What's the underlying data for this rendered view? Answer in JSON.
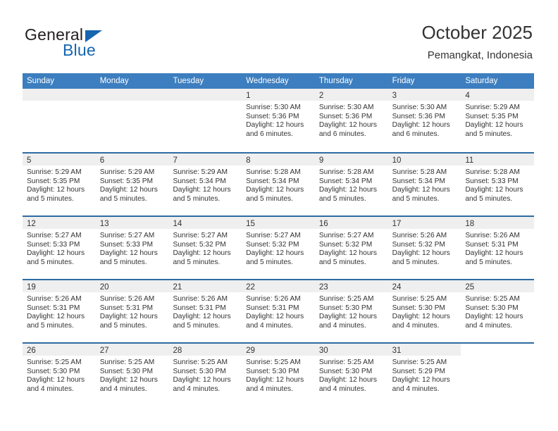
{
  "brand": {
    "name_part1": "General",
    "name_part2": "Blue"
  },
  "header": {
    "title": "October 2025",
    "subtitle": "Pemangkat, Indonesia"
  },
  "colors": {
    "header_blue": "#3c7ebf",
    "row_divider_blue": "#2e6ca4",
    "daynum_band": "#efefef",
    "logo_blue": "#1565b0",
    "text": "#333333"
  },
  "weekdays": [
    "Sunday",
    "Monday",
    "Tuesday",
    "Wednesday",
    "Thursday",
    "Friday",
    "Saturday"
  ],
  "labels": {
    "sunrise_prefix": "Sunrise:",
    "sunset_prefix": "Sunset:",
    "daylight_prefix": "Daylight:"
  },
  "weeks": [
    {
      "days": [
        {
          "day": "",
          "empty": true
        },
        {
          "day": "",
          "empty": true
        },
        {
          "day": "",
          "empty": true
        },
        {
          "day": "1",
          "sunrise": "Sunrise: 5:30 AM",
          "sunset": "Sunset: 5:36 PM",
          "daylight_line1": "Daylight: 12 hours",
          "daylight_line2": "and 6 minutes."
        },
        {
          "day": "2",
          "sunrise": "Sunrise: 5:30 AM",
          "sunset": "Sunset: 5:36 PM",
          "daylight_line1": "Daylight: 12 hours",
          "daylight_line2": "and 6 minutes."
        },
        {
          "day": "3",
          "sunrise": "Sunrise: 5:30 AM",
          "sunset": "Sunset: 5:36 PM",
          "daylight_line1": "Daylight: 12 hours",
          "daylight_line2": "and 6 minutes."
        },
        {
          "day": "4",
          "sunrise": "Sunrise: 5:29 AM",
          "sunset": "Sunset: 5:35 PM",
          "daylight_line1": "Daylight: 12 hours",
          "daylight_line2": "and 5 minutes."
        }
      ]
    },
    {
      "days": [
        {
          "day": "5",
          "sunrise": "Sunrise: 5:29 AM",
          "sunset": "Sunset: 5:35 PM",
          "daylight_line1": "Daylight: 12 hours",
          "daylight_line2": "and 5 minutes."
        },
        {
          "day": "6",
          "sunrise": "Sunrise: 5:29 AM",
          "sunset": "Sunset: 5:35 PM",
          "daylight_line1": "Daylight: 12 hours",
          "daylight_line2": "and 5 minutes."
        },
        {
          "day": "7",
          "sunrise": "Sunrise: 5:29 AM",
          "sunset": "Sunset: 5:34 PM",
          "daylight_line1": "Daylight: 12 hours",
          "daylight_line2": "and 5 minutes."
        },
        {
          "day": "8",
          "sunrise": "Sunrise: 5:28 AM",
          "sunset": "Sunset: 5:34 PM",
          "daylight_line1": "Daylight: 12 hours",
          "daylight_line2": "and 5 minutes."
        },
        {
          "day": "9",
          "sunrise": "Sunrise: 5:28 AM",
          "sunset": "Sunset: 5:34 PM",
          "daylight_line1": "Daylight: 12 hours",
          "daylight_line2": "and 5 minutes."
        },
        {
          "day": "10",
          "sunrise": "Sunrise: 5:28 AM",
          "sunset": "Sunset: 5:34 PM",
          "daylight_line1": "Daylight: 12 hours",
          "daylight_line2": "and 5 minutes."
        },
        {
          "day": "11",
          "sunrise": "Sunrise: 5:28 AM",
          "sunset": "Sunset: 5:33 PM",
          "daylight_line1": "Daylight: 12 hours",
          "daylight_line2": "and 5 minutes."
        }
      ]
    },
    {
      "days": [
        {
          "day": "12",
          "sunrise": "Sunrise: 5:27 AM",
          "sunset": "Sunset: 5:33 PM",
          "daylight_line1": "Daylight: 12 hours",
          "daylight_line2": "and 5 minutes."
        },
        {
          "day": "13",
          "sunrise": "Sunrise: 5:27 AM",
          "sunset": "Sunset: 5:33 PM",
          "daylight_line1": "Daylight: 12 hours",
          "daylight_line2": "and 5 minutes."
        },
        {
          "day": "14",
          "sunrise": "Sunrise: 5:27 AM",
          "sunset": "Sunset: 5:32 PM",
          "daylight_line1": "Daylight: 12 hours",
          "daylight_line2": "and 5 minutes."
        },
        {
          "day": "15",
          "sunrise": "Sunrise: 5:27 AM",
          "sunset": "Sunset: 5:32 PM",
          "daylight_line1": "Daylight: 12 hours",
          "daylight_line2": "and 5 minutes."
        },
        {
          "day": "16",
          "sunrise": "Sunrise: 5:27 AM",
          "sunset": "Sunset: 5:32 PM",
          "daylight_line1": "Daylight: 12 hours",
          "daylight_line2": "and 5 minutes."
        },
        {
          "day": "17",
          "sunrise": "Sunrise: 5:26 AM",
          "sunset": "Sunset: 5:32 PM",
          "daylight_line1": "Daylight: 12 hours",
          "daylight_line2": "and 5 minutes."
        },
        {
          "day": "18",
          "sunrise": "Sunrise: 5:26 AM",
          "sunset": "Sunset: 5:31 PM",
          "daylight_line1": "Daylight: 12 hours",
          "daylight_line2": "and 5 minutes."
        }
      ]
    },
    {
      "days": [
        {
          "day": "19",
          "sunrise": "Sunrise: 5:26 AM",
          "sunset": "Sunset: 5:31 PM",
          "daylight_line1": "Daylight: 12 hours",
          "daylight_line2": "and 5 minutes."
        },
        {
          "day": "20",
          "sunrise": "Sunrise: 5:26 AM",
          "sunset": "Sunset: 5:31 PM",
          "daylight_line1": "Daylight: 12 hours",
          "daylight_line2": "and 5 minutes."
        },
        {
          "day": "21",
          "sunrise": "Sunrise: 5:26 AM",
          "sunset": "Sunset: 5:31 PM",
          "daylight_line1": "Daylight: 12 hours",
          "daylight_line2": "and 5 minutes."
        },
        {
          "day": "22",
          "sunrise": "Sunrise: 5:26 AM",
          "sunset": "Sunset: 5:31 PM",
          "daylight_line1": "Daylight: 12 hours",
          "daylight_line2": "and 4 minutes."
        },
        {
          "day": "23",
          "sunrise": "Sunrise: 5:25 AM",
          "sunset": "Sunset: 5:30 PM",
          "daylight_line1": "Daylight: 12 hours",
          "daylight_line2": "and 4 minutes."
        },
        {
          "day": "24",
          "sunrise": "Sunrise: 5:25 AM",
          "sunset": "Sunset: 5:30 PM",
          "daylight_line1": "Daylight: 12 hours",
          "daylight_line2": "and 4 minutes."
        },
        {
          "day": "25",
          "sunrise": "Sunrise: 5:25 AM",
          "sunset": "Sunset: 5:30 PM",
          "daylight_line1": "Daylight: 12 hours",
          "daylight_line2": "and 4 minutes."
        }
      ]
    },
    {
      "days": [
        {
          "day": "26",
          "sunrise": "Sunrise: 5:25 AM",
          "sunset": "Sunset: 5:30 PM",
          "daylight_line1": "Daylight: 12 hours",
          "daylight_line2": "and 4 minutes."
        },
        {
          "day": "27",
          "sunrise": "Sunrise: 5:25 AM",
          "sunset": "Sunset: 5:30 PM",
          "daylight_line1": "Daylight: 12 hours",
          "daylight_line2": "and 4 minutes."
        },
        {
          "day": "28",
          "sunrise": "Sunrise: 5:25 AM",
          "sunset": "Sunset: 5:30 PM",
          "daylight_line1": "Daylight: 12 hours",
          "daylight_line2": "and 4 minutes."
        },
        {
          "day": "29",
          "sunrise": "Sunrise: 5:25 AM",
          "sunset": "Sunset: 5:30 PM",
          "daylight_line1": "Daylight: 12 hours",
          "daylight_line2": "and 4 minutes."
        },
        {
          "day": "30",
          "sunrise": "Sunrise: 5:25 AM",
          "sunset": "Sunset: 5:30 PM",
          "daylight_line1": "Daylight: 12 hours",
          "daylight_line2": "and 4 minutes."
        },
        {
          "day": "31",
          "sunrise": "Sunrise: 5:25 AM",
          "sunset": "Sunset: 5:29 PM",
          "daylight_line1": "Daylight: 12 hours",
          "daylight_line2": "and 4 minutes."
        },
        {
          "day": "",
          "empty": true,
          "no_band": true
        }
      ]
    }
  ]
}
